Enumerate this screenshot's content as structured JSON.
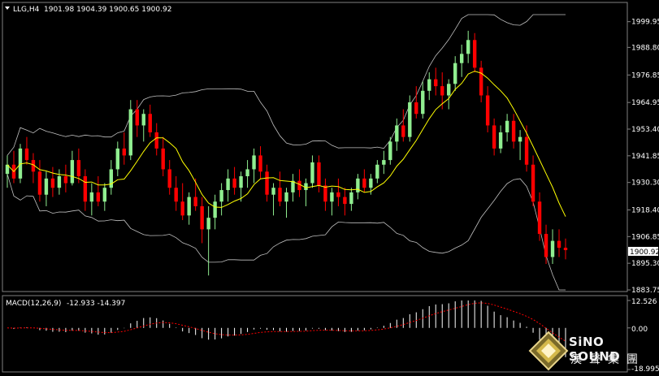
{
  "main_header": {
    "menu_arrow": "triangle-down-icon",
    "symbol": "LLG,H4",
    "ohlc": "1901.98 1904.39 1900.65 1900.92"
  },
  "price_axis": {
    "labels": [
      "1999.95",
      "1988.80",
      "1976.85",
      "1964.95",
      "1953.40",
      "1941.85",
      "1930.30",
      "1918.40",
      "1906.85",
      "1895.30",
      "1883.75"
    ],
    "current_price": "1900.92"
  },
  "macd_header": {
    "label": "MACD(12,26,9)",
    "values": "-12.933 -14.397"
  },
  "macd_axis": {
    "labels": [
      "12.526",
      "0.00",
      "-18.995"
    ]
  },
  "logo": {
    "line1": "SiNO SOUND",
    "line2": "漢聲集團",
    "icon": "diamond-logo-icon"
  },
  "colors": {
    "background": "#000000",
    "bull_candle": "#90ee90",
    "bear_candle": "#ff0000",
    "moving_average": "#ffff00",
    "bollinger_band": "#c0c0c0",
    "macd_hist": "#ffffff",
    "macd_signal": "#ff0000",
    "grid": "#808080"
  },
  "chart_data": [
    {
      "type": "candlestick",
      "title": "LLG,H4",
      "ylim": [
        1883.75,
        2003
      ],
      "yticks": [
        1999.95,
        1988.8,
        1976.85,
        1964.95,
        1953.4,
        1941.85,
        1930.3,
        1918.4,
        1906.85,
        1895.3,
        1883.75
      ],
      "last_price": 1900.92,
      "candles": [
        [
          1934,
          1942,
          1928,
          1938
        ],
        [
          1938,
          1944,
          1930,
          1932
        ],
        [
          1932,
          1947,
          1930,
          1945
        ],
        [
          1945,
          1950,
          1938,
          1940
        ],
        [
          1940,
          1943,
          1930,
          1935
        ],
        [
          1935,
          1940,
          1922,
          1925
        ],
        [
          1925,
          1935,
          1920,
          1932
        ],
        [
          1932,
          1937,
          1924,
          1928
        ],
        [
          1928,
          1936,
          1925,
          1933
        ],
        [
          1933,
          1938,
          1926,
          1930
        ],
        [
          1930,
          1944,
          1929,
          1940
        ],
        [
          1940,
          1945,
          1930,
          1933
        ],
        [
          1933,
          1936,
          1918,
          1922
        ],
        [
          1922,
          1930,
          1916,
          1926
        ],
        [
          1926,
          1933,
          1920,
          1922
        ],
        [
          1922,
          1930,
          1918,
          1928
        ],
        [
          1928,
          1940,
          1925,
          1936
        ],
        [
          1936,
          1948,
          1933,
          1945
        ],
        [
          1945,
          1952,
          1938,
          1942
        ],
        [
          1942,
          1966,
          1940,
          1962
        ],
        [
          1962,
          1966,
          1950,
          1955
        ],
        [
          1955,
          1962,
          1948,
          1960
        ],
        [
          1960,
          1964,
          1950,
          1952
        ],
        [
          1952,
          1956,
          1942,
          1945
        ],
        [
          1945,
          1950,
          1933,
          1936
        ],
        [
          1936,
          1940,
          1925,
          1928
        ],
        [
          1928,
          1933,
          1918,
          1922
        ],
        [
          1922,
          1930,
          1914,
          1916
        ],
        [
          1916,
          1926,
          1912,
          1924
        ],
        [
          1924,
          1932,
          1918,
          1920
        ],
        [
          1920,
          1924,
          1904,
          1910
        ],
        [
          1910,
          1920,
          1890,
          1915
        ],
        [
          1915,
          1925,
          1910,
          1922
        ],
        [
          1922,
          1930,
          1916,
          1927
        ],
        [
          1927,
          1936,
          1922,
          1932
        ],
        [
          1932,
          1937,
          1925,
          1928
        ],
        [
          1928,
          1935,
          1922,
          1933
        ],
        [
          1933,
          1940,
          1928,
          1936
        ],
        [
          1936,
          1945,
          1930,
          1942
        ],
        [
          1942,
          1946,
          1932,
          1935
        ],
        [
          1935,
          1938,
          1922,
          1925
        ],
        [
          1925,
          1930,
          1916,
          1928
        ],
        [
          1928,
          1935,
          1920,
          1922
        ],
        [
          1922,
          1928,
          1915,
          1926
        ],
        [
          1926,
          1934,
          1922,
          1931
        ],
        [
          1931,
          1936,
          1924,
          1927
        ],
        [
          1927,
          1932,
          1920,
          1930
        ],
        [
          1930,
          1942,
          1928,
          1939
        ],
        [
          1939,
          1942,
          1926,
          1929
        ],
        [
          1929,
          1932,
          1918,
          1922
        ],
        [
          1922,
          1928,
          1916,
          1926
        ],
        [
          1926,
          1932,
          1920,
          1924
        ],
        [
          1924,
          1928,
          1916,
          1921
        ],
        [
          1921,
          1928,
          1918,
          1926
        ],
        [
          1926,
          1934,
          1923,
          1932
        ],
        [
          1932,
          1936,
          1926,
          1928
        ],
        [
          1928,
          1934,
          1925,
          1932
        ],
        [
          1932,
          1940,
          1930,
          1938
        ],
        [
          1938,
          1944,
          1934,
          1940
        ],
        [
          1940,
          1950,
          1938,
          1948
        ],
        [
          1948,
          1958,
          1944,
          1955
        ],
        [
          1955,
          1962,
          1948,
          1950
        ],
        [
          1950,
          1968,
          1948,
          1965
        ],
        [
          1965,
          1972,
          1958,
          1960
        ],
        [
          1960,
          1974,
          1958,
          1970
        ],
        [
          1970,
          1978,
          1966,
          1975
        ],
        [
          1975,
          1980,
          1968,
          1972
        ],
        [
          1972,
          1978,
          1962,
          1968
        ],
        [
          1968,
          1975,
          1962,
          1973
        ],
        [
          1973,
          1985,
          1970,
          1982
        ],
        [
          1982,
          1990,
          1976,
          1986
        ],
        [
          1986,
          1996,
          1982,
          1992
        ],
        [
          1992,
          1995,
          1978,
          1980
        ],
        [
          1980,
          1983,
          1965,
          1968
        ],
        [
          1968,
          1972,
          1952,
          1955
        ],
        [
          1955,
          1958,
          1942,
          1945
        ],
        [
          1945,
          1955,
          1943,
          1952
        ],
        [
          1952,
          1960,
          1948,
          1957
        ],
        [
          1957,
          1960,
          1945,
          1948
        ],
        [
          1948,
          1953,
          1940,
          1950
        ],
        [
          1950,
          1955,
          1935,
          1938
        ],
        [
          1938,
          1942,
          1920,
          1922
        ],
        [
          1922,
          1926,
          1905,
          1908
        ],
        [
          1908,
          1912,
          1895,
          1898
        ],
        [
          1898,
          1910,
          1895,
          1905
        ],
        [
          1905,
          1910,
          1898,
          1902
        ],
        [
          1902,
          1906,
          1897,
          1901
        ]
      ]
    },
    {
      "type": "bar",
      "title": "MACD(12,26,9)",
      "ylim": [
        -18.995,
        12.526
      ],
      "yticks": [
        12.526,
        0.0,
        -18.995
      ],
      "histogram_last": -12.933,
      "signal_last": -14.397
    }
  ]
}
